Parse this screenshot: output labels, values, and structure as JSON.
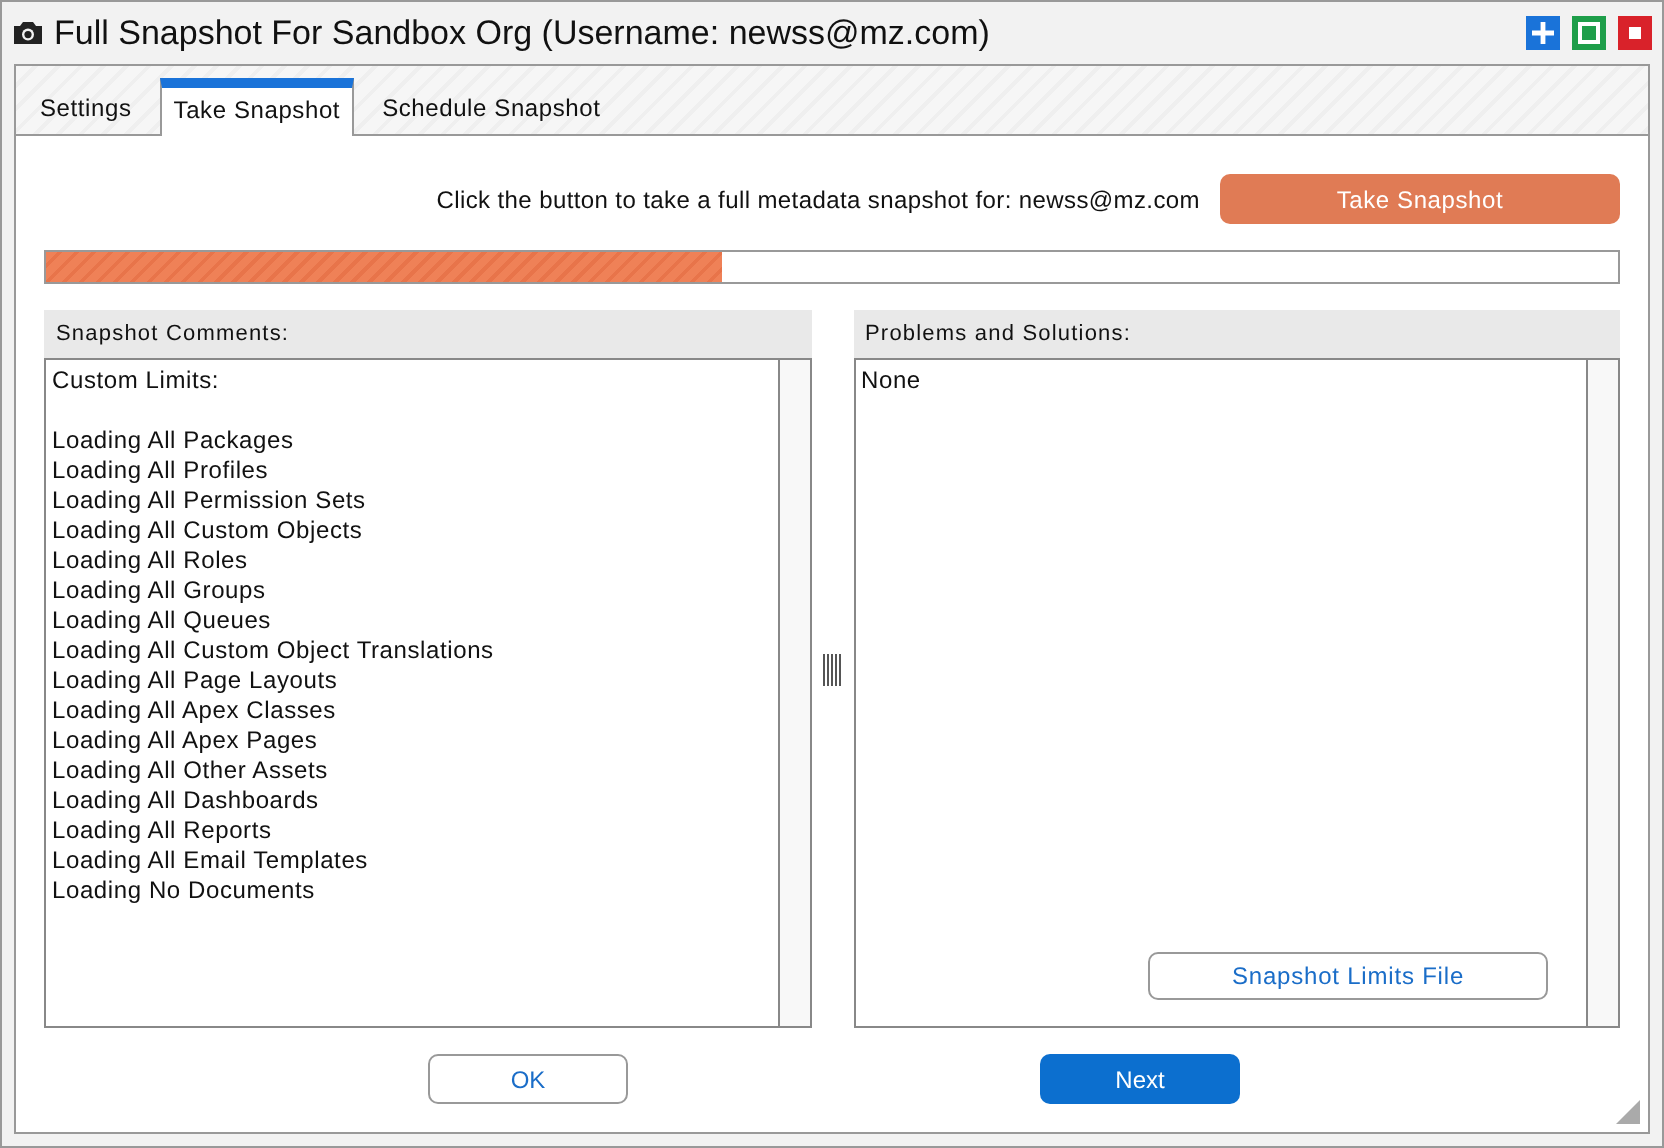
{
  "window": {
    "title": "Full Snapshot For Sandbox Org (Username: newss@mz.com)"
  },
  "window_buttons": [
    {
      "kind": "add"
    },
    {
      "kind": "maximize"
    },
    {
      "kind": "close"
    }
  ],
  "tabs": [
    {
      "label": "Settings",
      "selected": false
    },
    {
      "label": "Take Snapshot",
      "selected": true
    },
    {
      "label": "Schedule Snapshot",
      "selected": false
    }
  ],
  "prompt": "Click the button to take a full metadata snapshot for: newss@mz.com",
  "take_snapshot_button": "Take Snapshot",
  "progress": {
    "level": 0.43
  },
  "comments": {
    "title": "Snapshot Comments:",
    "heading": "Custom Limits:",
    "lines": [
      "Loading All Packages",
      "Loading All Profiles",
      "Loading All Permission Sets",
      "Loading All Custom Objects",
      "Loading All Roles",
      "Loading All Groups",
      "Loading All Queues",
      "Loading All Custom Object Translations",
      "Loading All Page Layouts",
      "Loading All Apex Classes",
      "Loading All Apex Pages",
      "Loading All Other Assets",
      "Loading All Dashboards",
      "Loading All Reports",
      "Loading All Email Templates",
      "Loading No Documents"
    ]
  },
  "problems": {
    "title": "Problems and Solutions:",
    "text": "None",
    "button": "Snapshot Limits File"
  },
  "buttons": [
    {
      "label": "OK",
      "kind": "secondary"
    },
    {
      "label": "Next",
      "kind": "primary"
    }
  ]
}
